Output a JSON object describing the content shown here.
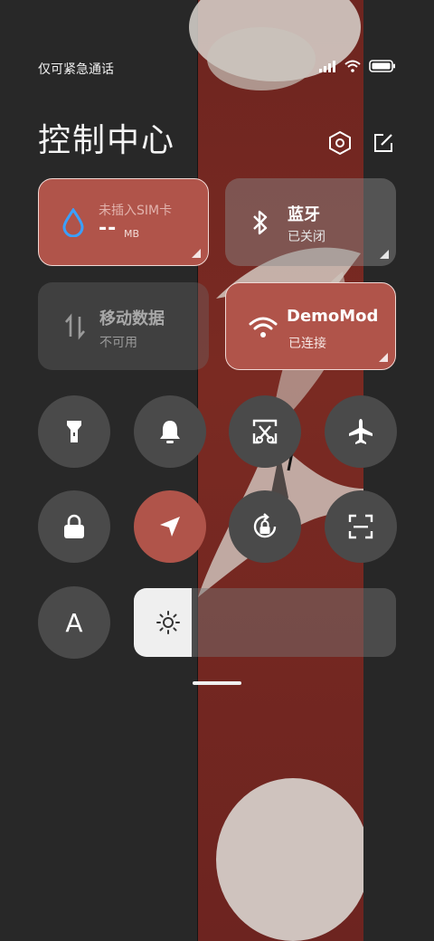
{
  "status_bar": {
    "carrier": "仅可紧急通话",
    "icons": [
      "signal-icon",
      "wifi-icon",
      "battery-icon"
    ]
  },
  "header": {
    "title": "控制中心",
    "settings_icon": "settings-hexagon-icon",
    "edit_icon": "edit-icon"
  },
  "tiles": {
    "data_usage": {
      "title": "未插入SIM卡",
      "value": "--",
      "unit": "MB",
      "icon": "water-drop-icon"
    },
    "bluetooth": {
      "title": "蓝牙",
      "status": "已关闭",
      "icon": "bluetooth-icon"
    },
    "mobile_data": {
      "title": "移动数据",
      "status": "不可用",
      "icon": "data-arrows-icon"
    },
    "wifi": {
      "title": "DemoMod",
      "status": "已连接",
      "icon": "wifi-icon"
    }
  },
  "toggles_row1": [
    "flashlight-icon",
    "bell-icon",
    "screenshot-scissors-icon",
    "airplane-icon"
  ],
  "toggles_row2": [
    "lock-icon",
    "location-icon",
    "rotation-lock-icon",
    "scan-icon"
  ],
  "bottom": {
    "font_label": "A",
    "brightness_icon": "sun-icon",
    "brightness_level": 0.22
  },
  "colors": {
    "accent_red": "#b0544a",
    "wallpaper_red": "#7a2a22",
    "background": "#262626"
  }
}
